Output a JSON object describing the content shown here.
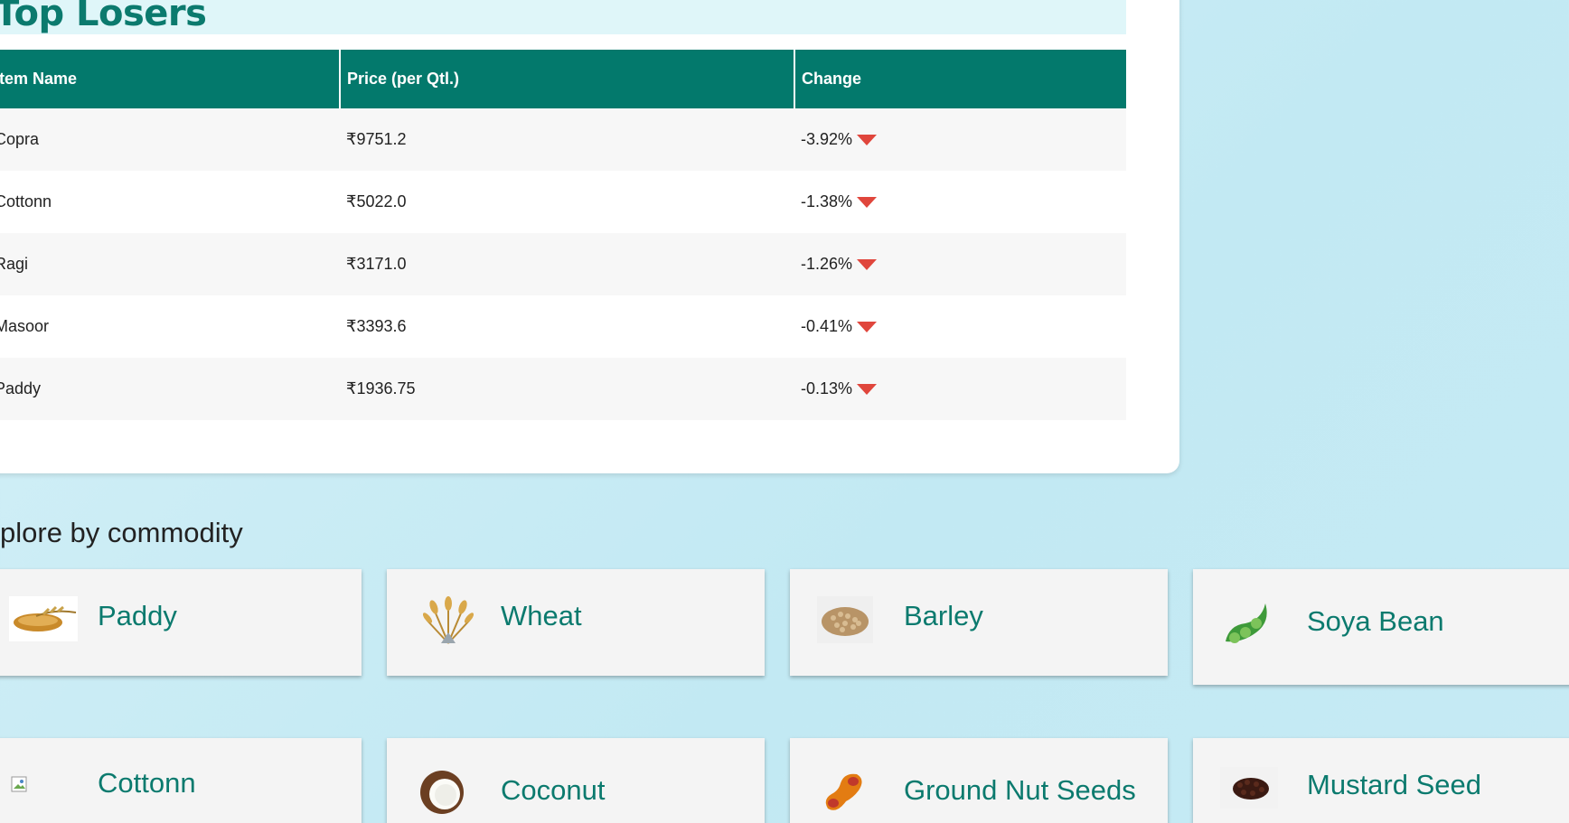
{
  "top_losers": {
    "title": "Top Losers",
    "columns": [
      "Item Name",
      "Price (per Qtl.)",
      "Change"
    ],
    "rows": [
      {
        "name": "Copra",
        "price": "₹9751.2",
        "change": "-3.92%"
      },
      {
        "name": "Cottonn",
        "price": "₹5022.0",
        "change": "-1.38%"
      },
      {
        "name": "Ragi",
        "price": "₹3171.0",
        "change": "-1.26%"
      },
      {
        "name": "Masoor",
        "price": "₹3393.6",
        "change": "-0.41%"
      },
      {
        "name": "Paddy",
        "price": "₹1936.75",
        "change": "-0.13%"
      }
    ],
    "change_color": "#e0463c",
    "header_color": "#03796c"
  },
  "explore": {
    "heading": "plore by commodity",
    "commodities": [
      {
        "name": "Paddy",
        "icon": "paddy-icon"
      },
      {
        "name": "Wheat",
        "icon": "wheat-icon"
      },
      {
        "name": "Barley",
        "icon": "barley-icon"
      },
      {
        "name": "Soya Bean",
        "icon": "soya-bean-icon"
      },
      {
        "name": "Cottonn",
        "icon": "broken-image-icon"
      },
      {
        "name": "Coconut",
        "icon": "coconut-icon"
      },
      {
        "name": "Ground Nut Seeds",
        "icon": "ground-nut-icon"
      },
      {
        "name": "Mustard Seed",
        "icon": "mustard-seed-icon"
      }
    ],
    "label_color": "#0b7a6e"
  }
}
